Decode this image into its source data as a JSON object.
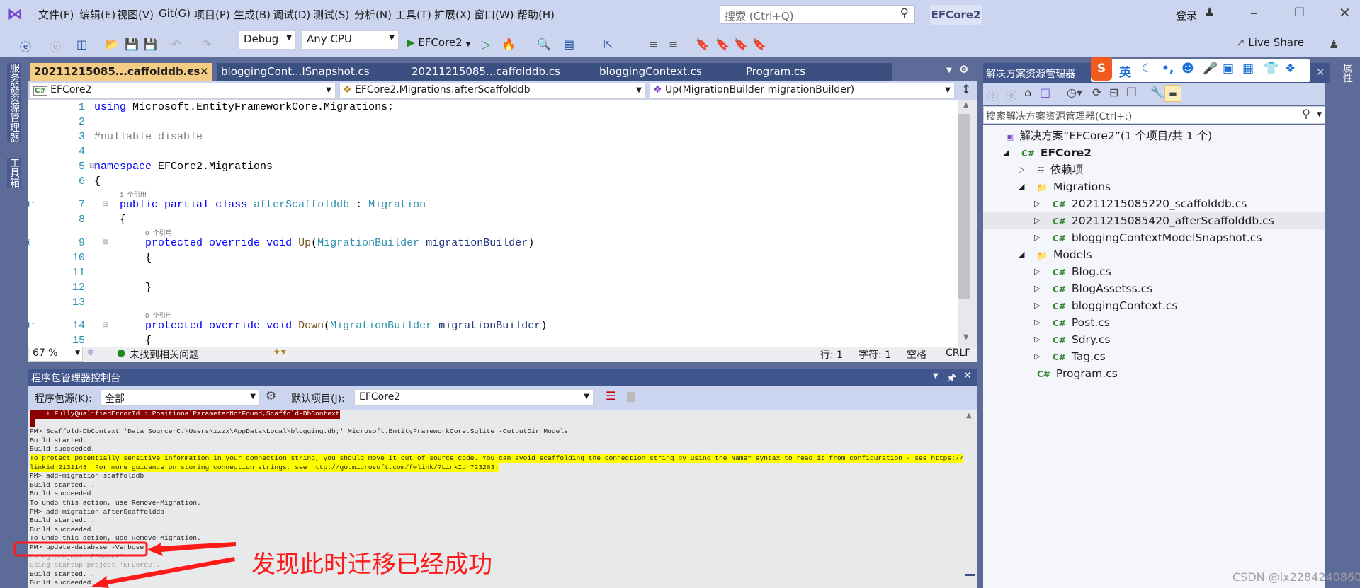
{
  "titlebar": {
    "menu": [
      "文件(F)",
      "编辑(E)",
      "视图(V)",
      "Git(G)",
      "项目(P)",
      "生成(B)",
      "调试(D)",
      "测试(S)",
      "分析(N)",
      "工具(T)",
      "扩展(X)",
      "窗口(W)",
      "帮助(H)"
    ],
    "search_placeholder": "搜索 (Ctrl+Q)",
    "solution_badge": "EFCore2",
    "login": "登录",
    "icons": [
      "visual-studio-logo",
      "search-icon",
      "add-user-icon",
      "minimize-icon",
      "restore-icon",
      "close-icon"
    ]
  },
  "toolbar": {
    "config": "Debug",
    "platform": "Any CPU",
    "run_target": "EFCore2",
    "live_share": "Live Share"
  },
  "left_strip": {
    "items": [
      "服务器资源管理器",
      "工具箱"
    ]
  },
  "right_strip": {
    "items": [
      "属性"
    ]
  },
  "editor": {
    "tabs": [
      "20211215085...caffolddb.cs",
      "bloggingCont...lSnapshot.cs",
      "20211215085...caffolddb.cs",
      "bloggingContext.cs",
      "Program.cs"
    ],
    "active_tab": 0,
    "nav": {
      "project": "EFCore2",
      "type": "EFCore2.Migrations.afterScaffolddb",
      "member": "Up(MigrationBuilder migrationBuilder)"
    },
    "lines": [
      {
        "n": "1",
        "tokens": [
          [
            "k",
            "using"
          ],
          [
            "n",
            " Microsoft.EntityFrameworkCore.Migrations;"
          ]
        ]
      },
      {
        "n": "2",
        "tokens": []
      },
      {
        "n": "3",
        "tokens": [
          [
            "p",
            "#nullable disable"
          ]
        ]
      },
      {
        "n": "4",
        "tokens": []
      },
      {
        "n": "5",
        "tokens": [
          [
            "k",
            "namespace"
          ],
          [
            "n",
            " EFCore2.Migrations"
          ]
        ]
      },
      {
        "n": "6",
        "tokens": [
          [
            "n",
            "{"
          ]
        ]
      },
      {
        "lens": "1 个引用",
        "indent": 4
      },
      {
        "n": "7",
        "marker": true,
        "tokens": [
          [
            "n",
            "    "
          ],
          [
            "k",
            "public"
          ],
          [
            "n",
            " "
          ],
          [
            "k",
            "partial"
          ],
          [
            "n",
            " "
          ],
          [
            "k",
            "class"
          ],
          [
            "n",
            " "
          ],
          [
            "t",
            "afterScaffolddb"
          ],
          [
            "n",
            " : "
          ],
          [
            "t",
            "Migration"
          ]
        ]
      },
      {
        "n": "8",
        "tokens": [
          [
            "n",
            "    {"
          ]
        ]
      },
      {
        "lens": "0 个引用",
        "indent": 8
      },
      {
        "n": "9",
        "marker": true,
        "tokens": [
          [
            "n",
            "        "
          ],
          [
            "k",
            "protected"
          ],
          [
            "n",
            " "
          ],
          [
            "k",
            "override"
          ],
          [
            "n",
            " "
          ],
          [
            "k",
            "void"
          ],
          [
            "n",
            " "
          ],
          [
            "m",
            "Up"
          ],
          [
            "n",
            "("
          ],
          [
            "t",
            "MigrationBuilder"
          ],
          [
            "n",
            " "
          ],
          [
            "pa",
            "migrationBuilder"
          ],
          [
            "n",
            ")"
          ]
        ]
      },
      {
        "n": "10",
        "tokens": [
          [
            "n",
            "        {"
          ]
        ]
      },
      {
        "n": "11",
        "tokens": []
      },
      {
        "n": "12",
        "tokens": [
          [
            "n",
            "        }"
          ]
        ]
      },
      {
        "n": "13",
        "tokens": []
      },
      {
        "lens": "0 个引用",
        "indent": 8
      },
      {
        "n": "14",
        "marker": true,
        "tokens": [
          [
            "n",
            "        "
          ],
          [
            "k",
            "protected"
          ],
          [
            "n",
            " "
          ],
          [
            "k",
            "override"
          ],
          [
            "n",
            " "
          ],
          [
            "k",
            "void"
          ],
          [
            "n",
            " "
          ],
          [
            "m",
            "Down"
          ],
          [
            "n",
            "("
          ],
          [
            "t",
            "MigrationBuilder"
          ],
          [
            "n",
            " "
          ],
          [
            "pa",
            "migrationBuilder"
          ],
          [
            "n",
            ")"
          ]
        ]
      },
      {
        "n": "15",
        "tokens": [
          [
            "n",
            "        {"
          ]
        ]
      }
    ],
    "status": {
      "zoom": "67 %",
      "issues": "未找到相关问题",
      "line": "行: 1",
      "char": "字符: 1",
      "spaces": "空格",
      "eol": "CRLF"
    }
  },
  "console": {
    "title": "程序包管理器控制台",
    "source_label": "程序包源(K):",
    "source_value": "全部",
    "project_label": "默认项目(J):",
    "project_value": "EFCore2",
    "lines": [
      {
        "style": "err",
        "text": "    + FullyQualifiedErrorId : PositionalParameterNotFound,Scaffold-DbContext"
      },
      {
        "style": "err",
        "text": " "
      },
      {
        "style": "",
        "text": "PM> Scaffold-DbContext 'Data Source=C:\\Users\\zzzx\\AppData\\Local\\blogging.db;' Microsoft.EntityFrameworkCore.Sqlite -OutputDir Models"
      },
      {
        "style": "",
        "text": "Build started..."
      },
      {
        "style": "",
        "text": "Build succeeded."
      },
      {
        "style": "warn",
        "text": "To protect potentially sensitive information in your connection string, you should move it out of source code. You can avoid scaffolding the connection string by using the Name= syntax to read it from configuration - see https://go.microsoft.com/fwlink/?"
      },
      {
        "style": "warn",
        "text": "linkid=2131148. For more guidance on storing connection strings, see http://go.microsoft.com/fwlink/?LinkId=723263."
      },
      {
        "style": "",
        "text": "PM> add-migration scaffolddb"
      },
      {
        "style": "",
        "text": "Build started..."
      },
      {
        "style": "",
        "text": "Build succeeded."
      },
      {
        "style": "",
        "text": "To undo this action, use Remove-Migration."
      },
      {
        "style": "",
        "text": "PM> add-migration afterScaffolddb"
      },
      {
        "style": "",
        "text": "Build started..."
      },
      {
        "style": "",
        "text": "Build succeeded."
      },
      {
        "style": "",
        "text": "To undo this action, use Remove-Migration."
      },
      {
        "style": "",
        "text": "PM> update-database -Verbose"
      },
      {
        "style": "dim",
        "text": "Using project 'EFCore2'."
      },
      {
        "style": "dim",
        "text": "Using startup project 'EFCore2'."
      },
      {
        "style": "",
        "text": "Build started..."
      },
      {
        "style": "",
        "text": "Build succeeded."
      }
    ]
  },
  "solution_explorer": {
    "title": "解决方案资源管理器",
    "ime": [
      "英"
    ],
    "search_placeholder": "搜索解决方案资源管理器(Ctrl+;)",
    "items": [
      {
        "label": "解决方案“EFCore2”(1 个项目/共 1 个)",
        "level": 0,
        "icon": "solution",
        "exp": ""
      },
      {
        "label": "EFCore2",
        "level": 1,
        "icon": "csproj",
        "exp": "open",
        "bold": true
      },
      {
        "label": "依赖项",
        "level": 2,
        "icon": "deps",
        "exp": "closed"
      },
      {
        "label": "Migrations",
        "level": 2,
        "icon": "folder",
        "exp": "open"
      },
      {
        "label": "20211215085220_scaffolddb.cs",
        "level": 3,
        "icon": "cs",
        "exp": "closed"
      },
      {
        "label": "20211215085420_afterScaffolddb.cs",
        "level": 3,
        "icon": "cs",
        "exp": "closed",
        "selected": true
      },
      {
        "label": "bloggingContextModelSnapshot.cs",
        "level": 3,
        "icon": "cs",
        "exp": "closed"
      },
      {
        "label": "Models",
        "level": 2,
        "icon": "folder",
        "exp": "open"
      },
      {
        "label": "Blog.cs",
        "level": 3,
        "icon": "cs",
        "exp": "closed"
      },
      {
        "label": "BlogAssetss.cs",
        "level": 3,
        "icon": "cs",
        "exp": "closed"
      },
      {
        "label": "bloggingContext.cs",
        "level": 3,
        "icon": "cs",
        "exp": "closed"
      },
      {
        "label": "Post.cs",
        "level": 3,
        "icon": "cs",
        "exp": "closed"
      },
      {
        "label": "Sdry.cs",
        "level": 3,
        "icon": "cs",
        "exp": "closed"
      },
      {
        "label": "Tag.cs",
        "level": 3,
        "icon": "cs",
        "exp": "closed"
      },
      {
        "label": "Program.cs",
        "level": 2,
        "icon": "cs",
        "exp": ""
      }
    ]
  },
  "annotation": {
    "text": "发现此时迁移已经成功",
    "color": "#ff0000"
  },
  "watermark": "CSDN @lx2284240860",
  "colors": {
    "frame": "#5d6b99",
    "chrome": "#ccd5f0",
    "active_tab": "#f5cc84",
    "tab": "#3b4f81",
    "panel_header": "#40568d",
    "keyword": "#0000ff",
    "type": "#2b91af"
  }
}
